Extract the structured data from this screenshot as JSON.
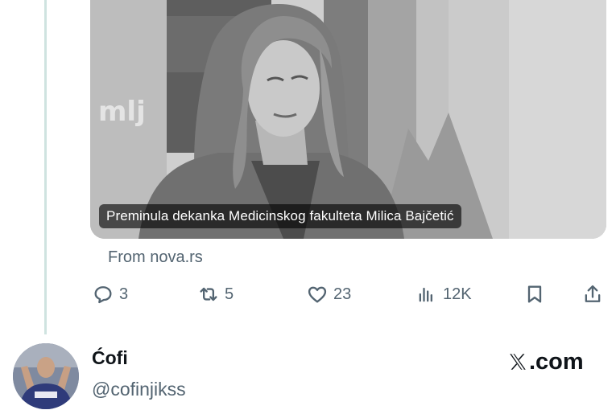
{
  "tweet": {
    "media": {
      "caption": "Preminula dekanka Medicinskog fakulteta Milica Bajčetić",
      "source": "From nova.rs"
    },
    "actions": {
      "replies": "3",
      "reposts": "5",
      "likes": "23",
      "views": "12K"
    }
  },
  "quoted_author": {
    "name": "Ćofi",
    "handle": "@cofinjikss",
    "brand": ".com"
  },
  "icons": {
    "reply": "reply-icon",
    "repost": "repost-icon",
    "like": "heart-icon",
    "views": "views-icon",
    "bookmark": "bookmark-icon",
    "share": "share-icon",
    "brand": "x-logo-icon"
  },
  "colors": {
    "secondary_text": "#536471",
    "primary_text": "#0f1419",
    "thread_line": "#cfe3e0"
  }
}
